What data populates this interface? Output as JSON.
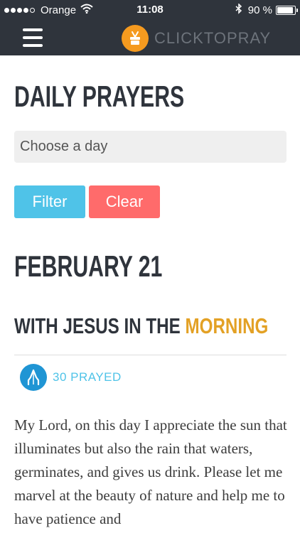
{
  "status_bar": {
    "carrier": "Orange",
    "time": "11:08",
    "battery": "90 %",
    "battery_level": 0.9,
    "signal_bars": 4
  },
  "header": {
    "logo_text": "CLICKTOPRAY",
    "menu_icon": "hamburger-icon",
    "logo_icon": "praying-hands-logo-icon"
  },
  "main": {
    "title": "DAILY PRAYERS",
    "day_select_placeholder": "Choose a day",
    "filter_label": "Filter",
    "clear_label": "Clear",
    "date_heading": "FEBRUARY 21",
    "prayer_title_main": "WITH JESUS IN THE",
    "prayer_title_accent": "MORNING",
    "prayed_count": "30 PRAYED",
    "prayer_text": "My Lord, on this day I appreciate the sun that illuminates but also the rain that waters, germinates, and gives us drink. Please let me marvel at the beauty of nature and help me to have patience and"
  },
  "colors": {
    "header_bg": "#2f343c",
    "logo_orange": "#f59a1f",
    "filter_button": "#4fc3e8",
    "clear_button": "#ff6b6b",
    "accent_gold": "#e3a125",
    "pray_icon_blue": "#1f95d4"
  }
}
